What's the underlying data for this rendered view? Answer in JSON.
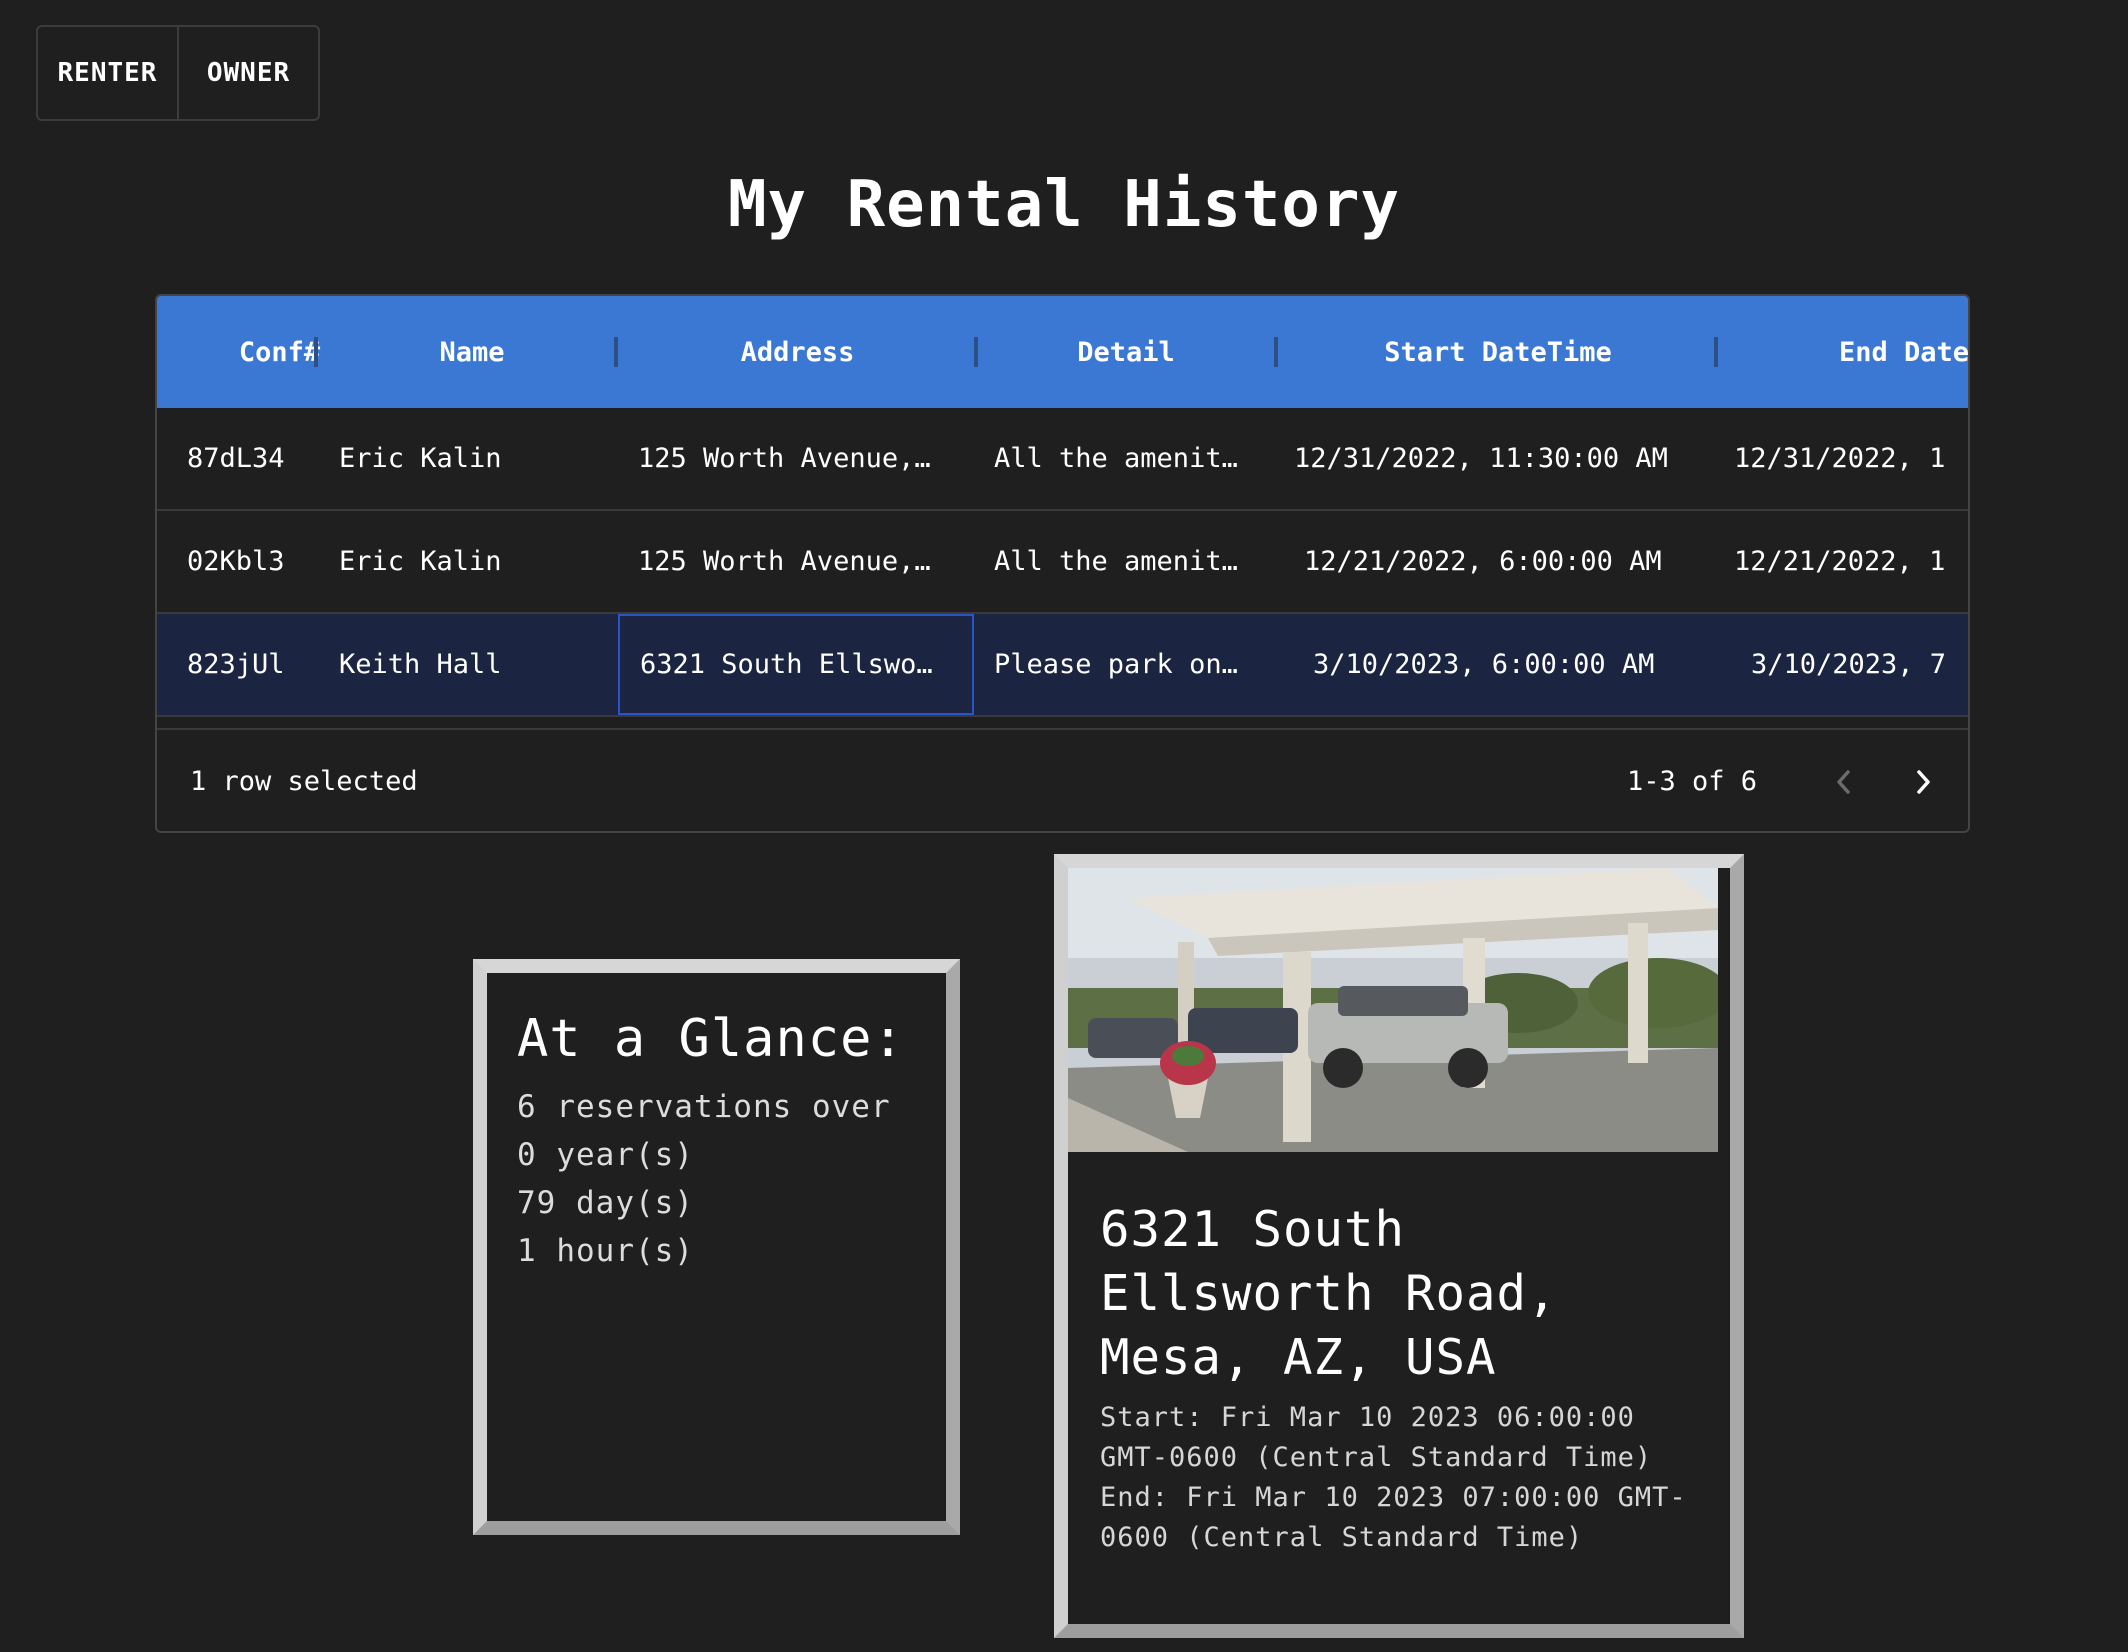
{
  "toggle": {
    "renter_label": "RENTER",
    "owner_label": "OWNER"
  },
  "page": {
    "title": "My Rental History"
  },
  "grid": {
    "columns": [
      "Conf#",
      "Name",
      "Address",
      "Detail",
      "Start DateTime",
      "End Date"
    ],
    "rows": [
      [
        "87dL34",
        "Eric Kalin",
        "125 Worth Avenue,…",
        "All the amenit…",
        "12/31/2022, 11:30:00 AM",
        "12/31/2022, 1"
      ],
      [
        "02Kbl3",
        "Eric Kalin",
        "125 Worth Avenue,…",
        "All the amenit…",
        "12/21/2022, 6:00:00 AM",
        "12/21/2022, 1"
      ],
      [
        "823jUl",
        "Keith Hall",
        "6321 South Ellswo…",
        "Please park on…",
        "3/10/2023, 6:00:00 AM",
        "3/10/2023, 7"
      ]
    ],
    "selected_row": 2,
    "footer": {
      "selected_text": "1 row selected",
      "pagination": "1-3 of 6"
    },
    "colors": {
      "header_bg": "#3a78d3",
      "selected_row_bg": "#1b2440"
    }
  },
  "glance": {
    "title": "At a Glance:",
    "lines": [
      "6 reservations over",
      "0 year(s)",
      "79 day(s)",
      "1 hour(s)"
    ]
  },
  "detail": {
    "title": "6321 South Ellsworth Road, Mesa, AZ, USA",
    "start": "Start: Fri Mar 10 2023 06:00:00 GMT-0600 (Central Standard Time)",
    "end": "End: Fri Mar 10 2023 07:00:00 GMT-0600 (Central Standard Time)"
  },
  "icons": {
    "prev": "chevron-left-icon",
    "next": "chevron-right-icon"
  }
}
